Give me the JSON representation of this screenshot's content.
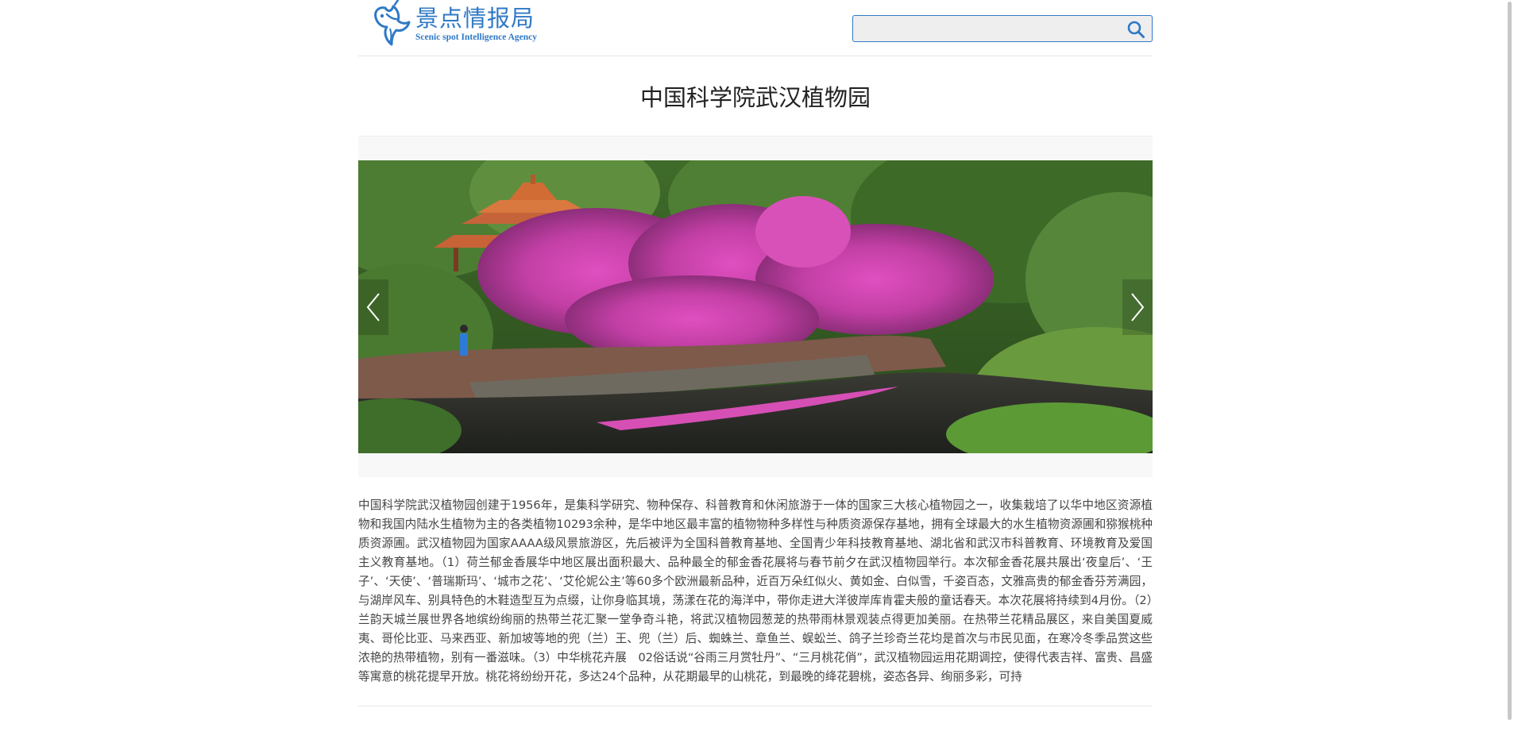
{
  "header": {
    "logo_title": "景点情报局",
    "logo_subtitle": "Scenic spot Intelligence Agency",
    "logo_icon": "bird-logo-icon",
    "search": {
      "value": "",
      "placeholder": "",
      "button_icon": "search-icon"
    }
  },
  "article": {
    "title": "中国科学院武汉植物园",
    "carousel": {
      "prev_icon": "chevron-left-icon",
      "next_icon": "chevron-right-icon"
    },
    "body": "中国科学院武汉植物园创建于1956年，是集科学研究、物种保存、科普教育和休闲旅游于一体的国家三大核心植物园之一，收集栽培了以华中地区资源植物和我国内陆水生植物为主的各类植物10293余种，是华中地区最丰富的植物物种多样性与种质资源保存基地，拥有全球最大的水生植物资源圃和猕猴桃种质资源圃。武汉植物园为国家AAAA级风景旅游区，先后被评为全国科普教育基地、全国青少年科技教育基地、湖北省和武汉市科普教育、环境教育及爱国主义教育基地。（1）荷兰郁金香展华中地区展出面积最大、品种最全的郁金香花展将与春节前夕在武汉植物园举行。本次郁金香花展共展出‘夜皇后’、‘王子’、‘天使’、‘普瑞斯玛’、‘城市之花’、‘艾伦妮公主’等60多个欧洲最新品种，近百万朵红似火、黄如金、白似雪，千姿百态，文雅高贵的郁金香芬芳满园，与湖岸风车、别具特色的木鞋造型互为点缀，让你身临其境，荡漾在花的海洋中，带你走进大洋彼岸库肯霍夫般的童话春天。本次花展将持续到4月份。（2）兰韵天城兰展世界各地缤纷绚丽的热带兰花汇聚一堂争奇斗艳，将武汉植物园葱茏的热带雨林景观装点得更加美丽。在热带兰花精品展区，来自美国夏威夷、哥伦比亚、马来西亚、新加坡等地的兜（兰）王、兜（兰）后、蜘蛛兰、章鱼兰、蜈蚣兰、鸽子兰珍奇兰花均是首次与市民见面，在寒冷冬季品赏这些浓艳的热带植物，别有一番滋味。（3）中华桃花卉展　02俗话说“谷雨三月赏牡丹”、“三月桃花俏”，武汉植物园运用花期调控，使得代表吉祥、富贵、昌盛等寓意的桃花提早开放。桃花将纷纷开花，多达24个品种，从花期最早的山桃花，到最晚的绛花碧桃，姿态各异、绚丽多彩，可持"
  },
  "colors": {
    "brand": "#2f79c6",
    "search_bg": "#eeeeee",
    "text": "#444444"
  }
}
